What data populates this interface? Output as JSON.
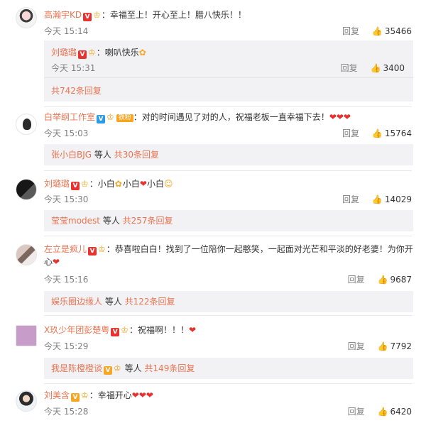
{
  "colors": {
    "username": "#eb7350",
    "text": "#333333",
    "muted": "#808080",
    "subbox_bg": "#f2f2f5",
    "heart": "#e8322f"
  },
  "comments": [
    {
      "name": "高瀚宇KD",
      "text": "：幸福至上！开心至上！腊八快乐！！",
      "time": "今天 15:14",
      "reply": "回复",
      "likes": "35466",
      "sub_reply": {
        "name": "刘璐璐",
        "text": "：喇叭快乐",
        "time": "今天 15:31",
        "reply": "回复",
        "likes": "3400"
      },
      "more": "共742条回复"
    },
    {
      "name": "白举纲工作室",
      "badge": "铁粉",
      "text": "：对的时间遇见了对的人，祝福老板一直幸福下去！",
      "time": "今天 15:03",
      "reply": "回复",
      "likes": "15764",
      "more_user": "张小白BJG",
      "more_mid": " 等人 ",
      "more": "共30条回复"
    },
    {
      "name": "刘璐璐",
      "text_a": "：小白",
      "text_b": "小白",
      "text_c": "小白",
      "time": "今天 15:30",
      "reply": "回复",
      "likes": "14029",
      "more_user": "莹莹modest",
      "more_mid": " 等人 ",
      "more": "共257条回复"
    },
    {
      "name": "左立是疯儿",
      "text": "：恭喜啦白白！找到了一位陪你一起憨笑，一起面对光芒和平淡的好老婆！为你开心",
      "time": "今天 15:16",
      "reply": "回复",
      "likes": "9687",
      "more_user": "娱乐圈边缘人",
      "more_mid": " 等人 ",
      "more": "共122条回复"
    },
    {
      "name": "X玖少年团彭楚粤",
      "text": "：祝福啊！！！",
      "time": "今天 15:29",
      "reply": "回复",
      "likes": "7792",
      "more_user": "我是陈橙橙谈",
      "more_mid": " 等人 ",
      "more": "共149条回复"
    },
    {
      "name": "刘美含",
      "text": "：幸福开心",
      "time": "今天 15:28",
      "reply": "回复",
      "likes": "6420"
    }
  ],
  "icons": {
    "thumb": "thumb-up-icon",
    "heart": "heart-icon",
    "crown": "crown-icon",
    "v": "verified-v-icon"
  }
}
